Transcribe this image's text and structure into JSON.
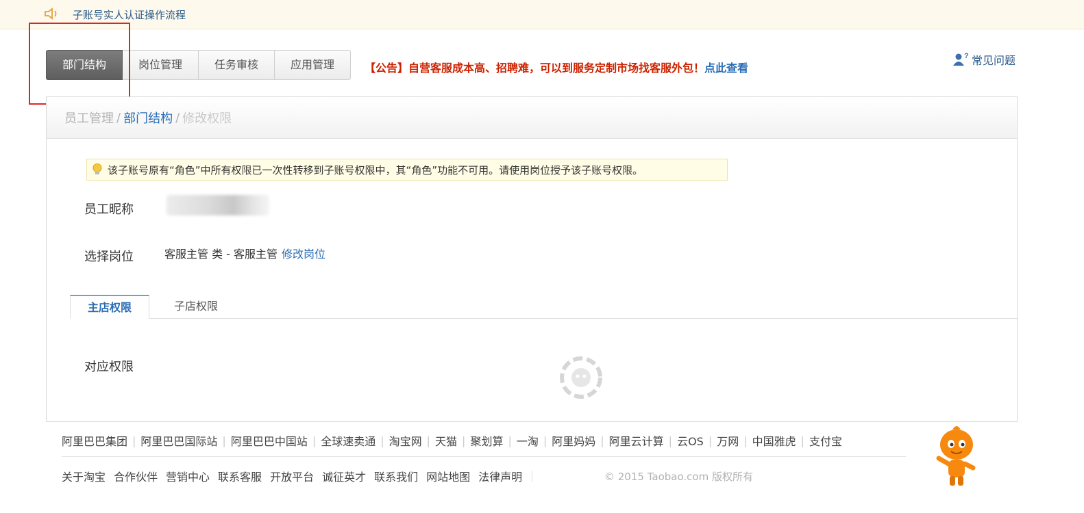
{
  "notice": {
    "icon": "speaker-icon",
    "text": "子账号实人认证操作流程"
  },
  "tabs": [
    {
      "label": "部门结构",
      "active": true
    },
    {
      "label": "岗位管理",
      "active": false
    },
    {
      "label": "任务审核",
      "active": false
    },
    {
      "label": "应用管理",
      "active": false
    }
  ],
  "announcement": {
    "text": "【公告】自营客服成本高、招聘难，可以到服务定制市场找客服外包！",
    "link": "点此查看"
  },
  "faq": {
    "icon": "faq-user-icon",
    "label": "常见问题"
  },
  "breadcrumb": {
    "item1": "员工管理",
    "sep": "/",
    "item2": "部门结构",
    "item3": "修改权限"
  },
  "tip": {
    "icon": "lightbulb-icon",
    "text": "该子账号原有“角色”中所有权限已一次性转移到子账号权限中，其“角色”功能不可用。请使用岗位授予该子账号权限。"
  },
  "form": {
    "nickname_label": "员工昵称",
    "position_label": "选择岗位",
    "position_value": "客服主管 类 - 客服主管",
    "change_position_link": "修改岗位",
    "permission_label": "对应权限"
  },
  "sub_tabs": [
    {
      "label": "主店权限",
      "active": true
    },
    {
      "label": "子店权限",
      "active": false
    }
  ],
  "footer": {
    "links_row1": [
      "阿里巴巴集团",
      "阿里巴巴国际站",
      "阿里巴巴中国站",
      "全球速卖通",
      "淘宝网",
      "天猫",
      "聚划算",
      "一淘",
      "阿里妈妈",
      "阿里云计算",
      "云OS",
      "万网",
      "中国雅虎",
      "支付宝"
    ],
    "links_row2": [
      "关于淘宝",
      "合作伙伴",
      "营销中心",
      "联系客服",
      "开放平台",
      "诚征英才",
      "联系我们",
      "网站地图",
      "法律声明"
    ],
    "copyright": "© 2015 Taobao.com 版权所有"
  },
  "colors": {
    "link": "#2a6db5",
    "announcement": "#cc2200",
    "highlight": "#e02424",
    "active_tab": "#666666"
  }
}
